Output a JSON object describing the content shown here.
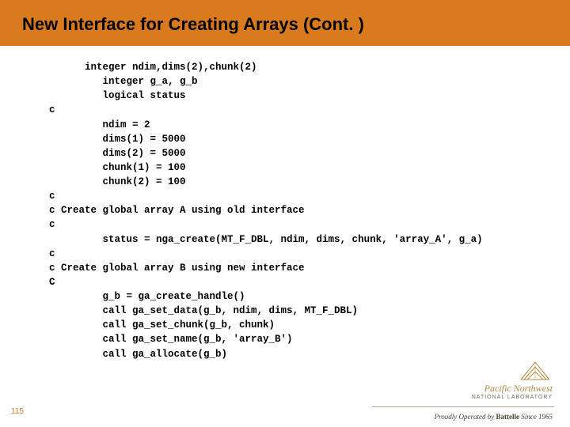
{
  "header": {
    "title": "New Interface for Creating Arrays (Cont. )"
  },
  "code": {
    "l1": "      integer ndim,dims(2),chunk(2)",
    "l2": "         integer g_a, g_b",
    "l3": "         logical status",
    "l4": "c",
    "l5": "         ndim = 2",
    "l6": "         dims(1) = 5000",
    "l7": "         dims(2) = 5000",
    "l8": "         chunk(1) = 100",
    "l9": "         chunk(2) = 100",
    "l10": "c",
    "l11": "c Create global array A using old interface",
    "l12": "c",
    "l13": "         status = nga_create(MT_F_DBL, ndim, dims, chunk, 'array_A', g_a)",
    "l14": "c",
    "l15": "c Create global array B using new interface",
    "l16": "C",
    "l17": "         g_b = ga_create_handle()",
    "l18": "         call ga_set_data(g_b, ndim, dims, MT_F_DBL)",
    "l19": "         call ga_set_chunk(g_b, chunk)",
    "l20": "         call ga_set_name(g_b, 'array_B')",
    "l21": "         call ga_allocate(g_b)"
  },
  "footer": {
    "page": "115",
    "lab_main": "Pacific Northwest",
    "lab_sub": "NATIONAL LABORATORY",
    "operated_prefix": "Proudly Operated by ",
    "operated_brand": "Battelle",
    "operated_suffix": " Since 1965"
  }
}
